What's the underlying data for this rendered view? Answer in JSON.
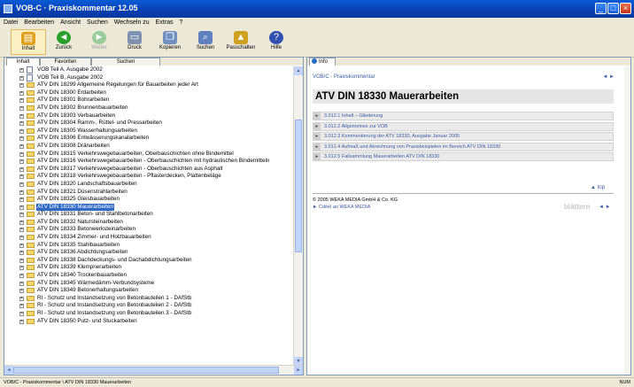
{
  "window": {
    "title": "VOB-C · Praxiskommentar 12.05"
  },
  "menu": [
    "Datei",
    "Bearbeiten",
    "Ansicht",
    "Suchen",
    "Wechseln zu",
    "Extras",
    "?"
  ],
  "toolbar": [
    {
      "label": "Inhalt",
      "icon": "book-icon",
      "color": "#e0a020"
    },
    {
      "label": "Zurück",
      "icon": "back-arrow-icon",
      "color": "#2aa02a"
    },
    {
      "label": "Weiter",
      "icon": "forward-arrow-icon",
      "color": "#9acc9a"
    },
    {
      "label": "Druck",
      "icon": "printer-icon",
      "color": "#8090b0"
    },
    {
      "label": "Kopieren",
      "icon": "copy-icon",
      "color": "#7090c0"
    },
    {
      "label": "Suchen",
      "icon": "search-icon",
      "color": "#6080c0"
    },
    {
      "label": "Passchalten",
      "icon": "lock-icon",
      "color": "#d0a020"
    },
    {
      "label": "Hilfe",
      "icon": "help-icon",
      "color": "#3050b0"
    }
  ],
  "left_tabs": [
    "Inhalt",
    "Favoriten",
    "Suchen"
  ],
  "tree": [
    {
      "label": "VOB Teil A, Ausgabe 2002",
      "type": "doc"
    },
    {
      "label": "VOB Teil B, Ausgabe 2002",
      "type": "doc"
    },
    {
      "label": "ATV DIN 18299 Allgemeine Regelungen für Bauarbeiten jeder Art",
      "type": "folder"
    },
    {
      "label": "ATV DIN 18300 Erdarbeiten",
      "type": "folder"
    },
    {
      "label": "ATV DIN 18301 Bohrarbeiten",
      "type": "folder"
    },
    {
      "label": "ATV DIN 18302 Brunnenbauarbeiten",
      "type": "folder"
    },
    {
      "label": "ATV DIN 18303 Verbauarbeiten",
      "type": "folder"
    },
    {
      "label": "ATV DIN 18304 Ramm-, Rüttel- und Pressarbeiten",
      "type": "folder"
    },
    {
      "label": "ATV DIN 18305 Wasserhaltungsarbeiten",
      "type": "folder"
    },
    {
      "label": "ATV DIN 18306 Entwässerungskanalarbeiten",
      "type": "folder"
    },
    {
      "label": "ATV DIN 18308 Dränarbeiten",
      "type": "folder"
    },
    {
      "label": "ATV DIN 18315 Verkehrswegebauarbeiten, Oberbauschichten ohne Bindemittel",
      "type": "folder"
    },
    {
      "label": "ATV DIN 18316 Verkehrswegebauarbeiten - Oberbauschichten mit hydraulischen Bindemitteln",
      "type": "folder"
    },
    {
      "label": "ATV DIN 18317 Verkehrswegebauarbeiten - Oberbauschichten aus Asphalt",
      "type": "folder"
    },
    {
      "label": "ATV DIN 18318 Verkehrswegebauarbeiten - Pflasterdecken, Plattenbeläge",
      "type": "folder"
    },
    {
      "label": "ATV DIN 18320 Landschaftsbauarbeiten",
      "type": "folder"
    },
    {
      "label": "ATV DIN 18321 Düsenstrahlarbeiten",
      "type": "folder"
    },
    {
      "label": "ATV DIN 18325 Gleisbauarbeiten",
      "type": "folder"
    },
    {
      "label": "ATV DIN 18330 Mauerarbeiten",
      "type": "folder",
      "selected": true
    },
    {
      "label": "ATV DIN 18331 Beton- und Stahlbetonarbeiten",
      "type": "folder"
    },
    {
      "label": "ATV DIN 18332 Natursteinarbeiten",
      "type": "folder"
    },
    {
      "label": "ATV DIN 18333 Betonwerksteinarbeiten",
      "type": "folder"
    },
    {
      "label": "ATV DIN 18334 Zimmer- und Holzbauarbeiten",
      "type": "folder"
    },
    {
      "label": "ATV DIN 18335 Stahlbauarbeiten",
      "type": "folder"
    },
    {
      "label": "ATV DIN 18336 Abdichtungsarbeiten",
      "type": "folder"
    },
    {
      "label": "ATV DIN 18338 Dachdeckungs- und Dachabdichtungsarbeiten",
      "type": "folder"
    },
    {
      "label": "ATV DIN 18339 Klempnerarbeiten",
      "type": "folder"
    },
    {
      "label": "ATV DIN 18340 Trockenbauarbeiten",
      "type": "folder"
    },
    {
      "label": "ATV DIN 18345 Wärmedämm-Verbundsysteme",
      "type": "folder"
    },
    {
      "label": "ATV DIN 18349 Betonerhaltungsarbeiten",
      "type": "folder"
    },
    {
      "label": "RI - Schutz und Instandsetzung von Betonbauteilen 1 - DAfStb",
      "type": "folder"
    },
    {
      "label": "RI - Schutz und Instandsetzung von Betonbauteilen 2 - DAfStb",
      "type": "folder"
    },
    {
      "label": "RI - Schutz und Instandsetzung von Betonbauteilen 3 - DAfStb",
      "type": "folder"
    },
    {
      "label": "ATV DIN 18350 Putz- und Stuckarbeiten",
      "type": "folder"
    }
  ],
  "info": {
    "tab_label": "Info",
    "breadcrumb": "VOB/C - Praxiskommentar",
    "nav": "◄  ►",
    "title": "ATV DIN 18330 Mauerarbeiten",
    "links": [
      "3.012.1 Inhalt – Gliederung",
      "3.012.2 Allgemeines zur VOB",
      "3.012.3 Kommentierung der ATV 18330, Ausgabe Januar 2005",
      "3.012.4 Aufmaß und Abrechnung von Praxisbeispielen im Bereich ATV DIN 18330",
      "3.012.5 Fallsammlung Mauerarbeiten ATV DIN 18330"
    ],
    "to_top": "▲ top",
    "copyright": "© 2005 WEKA MEDIA GmbH & Co. KG",
    "contact": "► Cdéel an WEKA MEDIA",
    "paging": "blättern",
    "paging_arrows": "◄  ►"
  },
  "status": {
    "text": "VOB/C - Praxiskommentar  \\  ATV DIN 18330 Mauerarbeiten",
    "mode": "NUM"
  }
}
